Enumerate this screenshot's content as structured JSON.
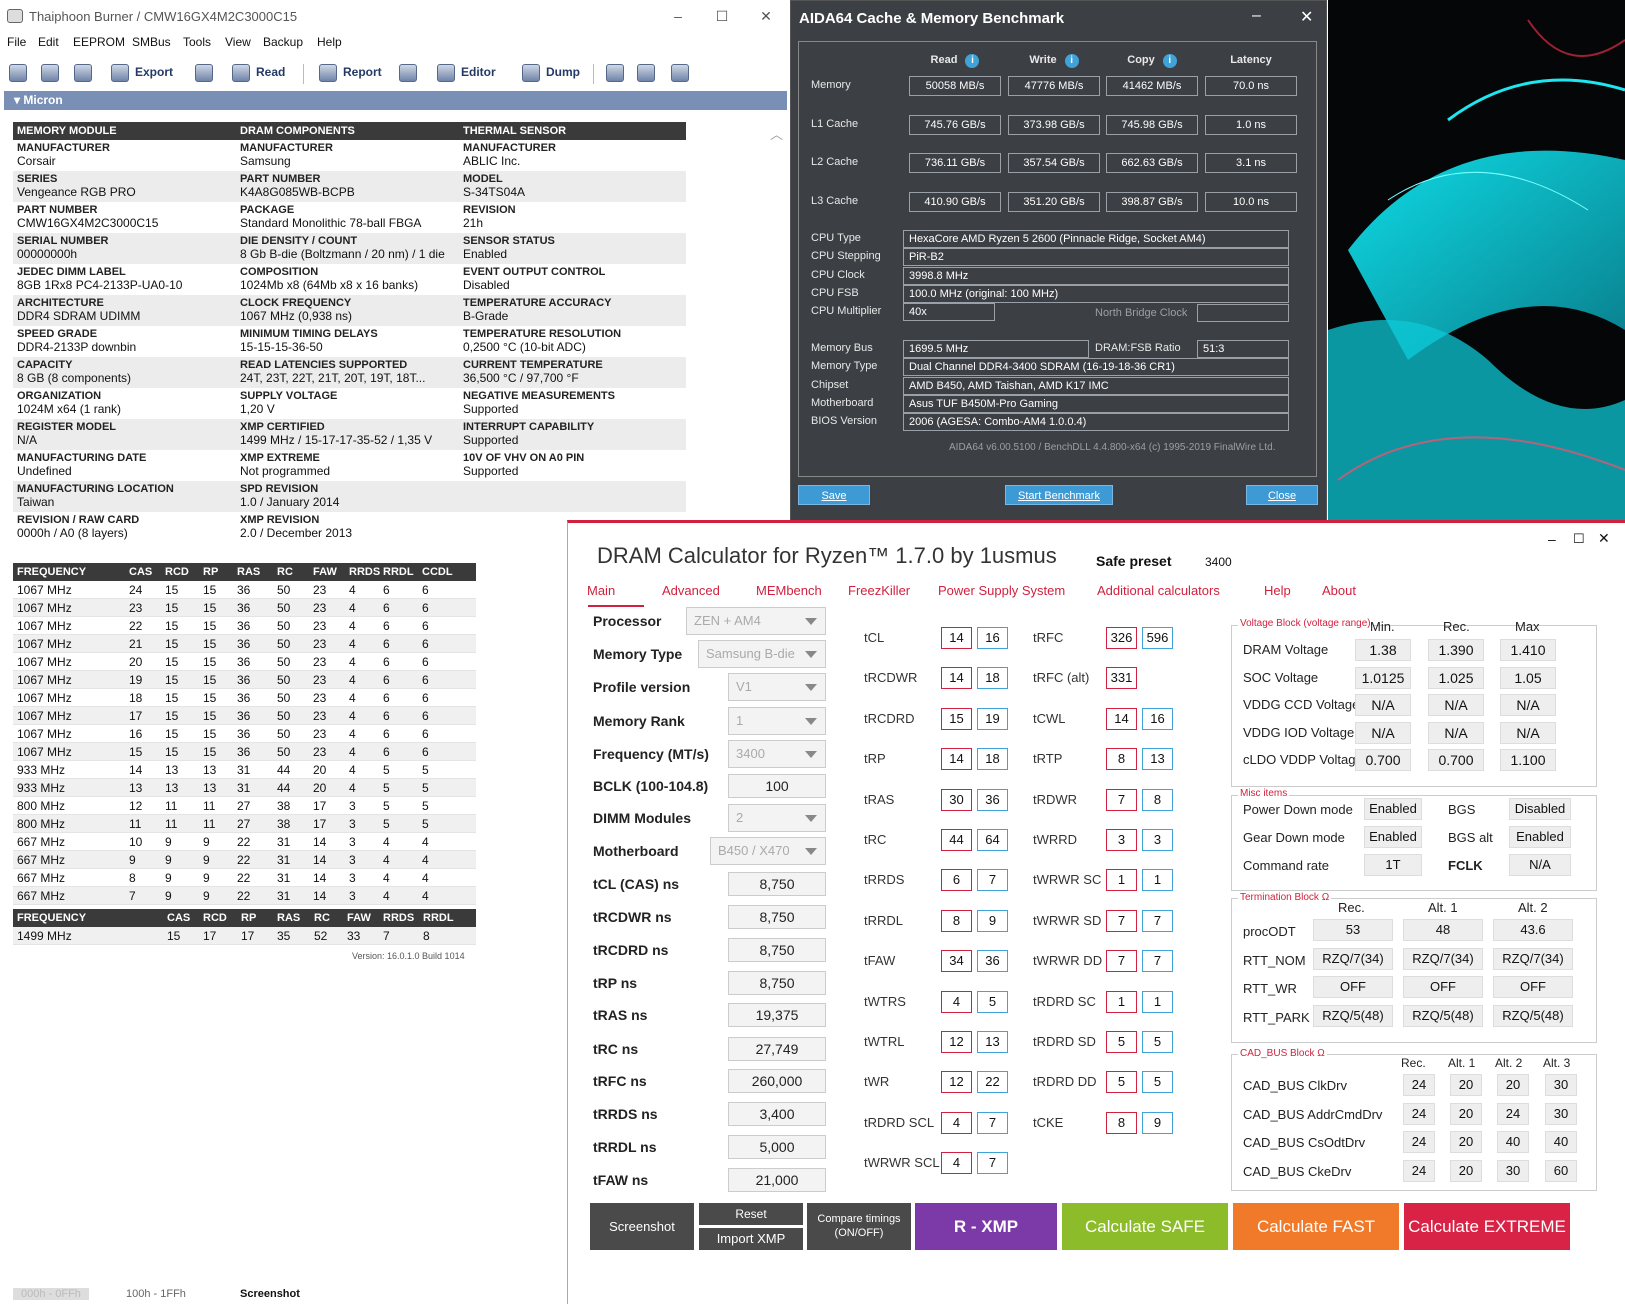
{
  "thaiphoon": {
    "title": "Thaiphoon Burner / CMW16GX4M2C3000C15",
    "menu": [
      "File",
      "Edit",
      "EEPROM",
      "SMBus",
      "Tools",
      "View",
      "Backup",
      "Help"
    ],
    "toolbar": {
      "export": "Export",
      "read": "Read",
      "report": "Report",
      "editor": "Editor",
      "dump": "Dump"
    },
    "band": "Micron",
    "sections": [
      {
        "header": "MEMORY MODULE",
        "rows": [
          [
            "MANUFACTURER",
            "Corsair"
          ],
          [
            "SERIES",
            "Vengeance RGB PRO"
          ],
          [
            "PART NUMBER",
            "CMW16GX4M2C3000C15"
          ],
          [
            "SERIAL NUMBER",
            "00000000h"
          ],
          [
            "JEDEC DIMM LABEL",
            "8GB 1Rx8 PC4-2133P-UA0-10"
          ],
          [
            "ARCHITECTURE",
            "DDR4 SDRAM UDIMM"
          ],
          [
            "SPEED GRADE",
            "DDR4-2133P downbin"
          ],
          [
            "CAPACITY",
            "8 GB (8 components)"
          ],
          [
            "ORGANIZATION",
            "1024M x64 (1 rank)"
          ],
          [
            "REGISTER MODEL",
            "N/A"
          ],
          [
            "MANUFACTURING DATE",
            "Undefined"
          ],
          [
            "MANUFACTURING LOCATION",
            "Taiwan"
          ],
          [
            "REVISION / RAW CARD",
            "0000h / A0 (8 layers)"
          ]
        ]
      },
      {
        "header": "DRAM COMPONENTS",
        "rows": [
          [
            "MANUFACTURER",
            "Samsung"
          ],
          [
            "PART NUMBER",
            "K4A8G085WB-BCPB"
          ],
          [
            "PACKAGE",
            "Standard Monolithic 78-ball FBGA"
          ],
          [
            "DIE DENSITY / COUNT",
            "8 Gb B-die (Boltzmann / 20 nm) / 1 die"
          ],
          [
            "COMPOSITION",
            "1024Mb x8 (64Mb x8 x 16 banks)"
          ],
          [
            "CLOCK FREQUENCY",
            "1067 MHz (0,938 ns)"
          ],
          [
            "MINIMUM TIMING DELAYS",
            "15-15-15-36-50"
          ],
          [
            "READ LATENCIES SUPPORTED",
            "24T, 23T, 22T, 21T, 20T, 19T, 18T..."
          ],
          [
            "SUPPLY VOLTAGE",
            "1,20 V"
          ],
          [
            "XMP CERTIFIED",
            "1499 MHz / 15-17-17-35-52 / 1,35 V"
          ],
          [
            "XMP EXTREME",
            "Not programmed"
          ],
          [
            "SPD REVISION",
            "1.0 / January 2014"
          ],
          [
            "XMP REVISION",
            "2.0 / December 2013"
          ]
        ]
      },
      {
        "header": "THERMAL SENSOR",
        "rows": [
          [
            "MANUFACTURER",
            "ABLIC Inc."
          ],
          [
            "MODEL",
            "S-34TS04A"
          ],
          [
            "REVISION",
            "21h"
          ],
          [
            "SENSOR STATUS",
            "Enabled"
          ],
          [
            "EVENT OUTPUT CONTROL",
            "Disabled"
          ],
          [
            "TEMPERATURE ACCURACY",
            "B-Grade"
          ],
          [
            "TEMPERATURE RESOLUTION",
            "0,2500 °C (10-bit ADC)"
          ],
          [
            "CURRENT TEMPERATURE",
            "36,500 °C / 97,700 °F"
          ],
          [
            "NEGATIVE MEASUREMENTS",
            "Supported"
          ],
          [
            "INTERRUPT CAPABILITY",
            "Supported"
          ],
          [
            "10V OF VHV ON A0 PIN",
            "Supported"
          ],
          [
            "",
            ""
          ],
          [
            "",
            ""
          ]
        ]
      }
    ],
    "freq_headers": [
      "FREQUENCY",
      "CAS",
      "RCD",
      "RP",
      "RAS",
      "RC",
      "FAW",
      "RRDS",
      "RRDL",
      "CCDL"
    ],
    "freq_rows": [
      [
        "1067 MHz",
        "24",
        "15",
        "15",
        "36",
        "50",
        "23",
        "4",
        "6",
        "6"
      ],
      [
        "1067 MHz",
        "23",
        "15",
        "15",
        "36",
        "50",
        "23",
        "4",
        "6",
        "6"
      ],
      [
        "1067 MHz",
        "22",
        "15",
        "15",
        "36",
        "50",
        "23",
        "4",
        "6",
        "6"
      ],
      [
        "1067 MHz",
        "21",
        "15",
        "15",
        "36",
        "50",
        "23",
        "4",
        "6",
        "6"
      ],
      [
        "1067 MHz",
        "20",
        "15",
        "15",
        "36",
        "50",
        "23",
        "4",
        "6",
        "6"
      ],
      [
        "1067 MHz",
        "19",
        "15",
        "15",
        "36",
        "50",
        "23",
        "4",
        "6",
        "6"
      ],
      [
        "1067 MHz",
        "18",
        "15",
        "15",
        "36",
        "50",
        "23",
        "4",
        "6",
        "6"
      ],
      [
        "1067 MHz",
        "17",
        "15",
        "15",
        "36",
        "50",
        "23",
        "4",
        "6",
        "6"
      ],
      [
        "1067 MHz",
        "16",
        "15",
        "15",
        "36",
        "50",
        "23",
        "4",
        "6",
        "6"
      ],
      [
        "1067 MHz",
        "15",
        "15",
        "15",
        "36",
        "50",
        "23",
        "4",
        "6",
        "6"
      ],
      [
        "933 MHz",
        "14",
        "13",
        "13",
        "31",
        "44",
        "20",
        "4",
        "5",
        "5"
      ],
      [
        "933 MHz",
        "13",
        "13",
        "13",
        "31",
        "44",
        "20",
        "4",
        "5",
        "5"
      ],
      [
        "800 MHz",
        "12",
        "11",
        "11",
        "27",
        "38",
        "17",
        "3",
        "5",
        "5"
      ],
      [
        "800 MHz",
        "11",
        "11",
        "11",
        "27",
        "38",
        "17",
        "3",
        "5",
        "5"
      ],
      [
        "667 MHz",
        "10",
        "9",
        "9",
        "22",
        "31",
        "14",
        "3",
        "4",
        "4"
      ],
      [
        "667 MHz",
        "9",
        "9",
        "9",
        "22",
        "31",
        "14",
        "3",
        "4",
        "4"
      ],
      [
        "667 MHz",
        "8",
        "9",
        "9",
        "22",
        "31",
        "14",
        "3",
        "4",
        "4"
      ],
      [
        "667 MHz",
        "7",
        "9",
        "9",
        "22",
        "31",
        "14",
        "3",
        "4",
        "4"
      ]
    ],
    "xmp_headers": [
      "FREQUENCY",
      "CAS",
      "RCD",
      "RP",
      "RAS",
      "RC",
      "FAW",
      "RRDS",
      "RRDL"
    ],
    "xmp_row": [
      "1499 MHz",
      "15",
      "17",
      "17",
      "35",
      "52",
      "33",
      "7",
      "8"
    ],
    "version": "Version: 16.0.1.0 Build 1014",
    "bottom_tabs": [
      "000h - 0FFh",
      "100h - 1FFh",
      "Screenshot"
    ]
  },
  "aida": {
    "title": "AIDA64 Cache & Memory Benchmark",
    "cols": [
      "Read",
      "Write",
      "Copy",
      "Latency"
    ],
    "rows": [
      {
        "label": "Memory",
        "vals": [
          "50058 MB/s",
          "47776 MB/s",
          "41462 MB/s",
          "70.0 ns"
        ]
      },
      {
        "label": "L1 Cache",
        "vals": [
          "745.76 GB/s",
          "373.98 GB/s",
          "745.98 GB/s",
          "1.0 ns"
        ]
      },
      {
        "label": "L2 Cache",
        "vals": [
          "736.11 GB/s",
          "357.54 GB/s",
          "662.63 GB/s",
          "3.1 ns"
        ]
      },
      {
        "label": "L3 Cache",
        "vals": [
          "410.90 GB/s",
          "351.20 GB/s",
          "398.87 GB/s",
          "10.0 ns"
        ]
      }
    ],
    "cpu": [
      {
        "label": "CPU Type",
        "value": "HexaCore AMD Ryzen 5 2600  (Pinnacle Ridge, Socket AM4)"
      },
      {
        "label": "CPU Stepping",
        "value": "PiR-B2"
      },
      {
        "label": "CPU Clock",
        "value": "3998.8 MHz"
      },
      {
        "label": "CPU FSB",
        "value": "100.0 MHz  (original: 100 MHz)"
      },
      {
        "label": "CPU Multiplier",
        "value": "40x"
      }
    ],
    "nb_label": "North Bridge Clock",
    "mem": [
      {
        "label": "Memory Bus",
        "value": "1699.5 MHz"
      },
      {
        "label": "Memory Type",
        "value": "Dual Channel DDR4-3400 SDRAM  (16-19-18-36 CR1)"
      },
      {
        "label": "Chipset",
        "value": "AMD B450, AMD Taishan, AMD K17 IMC"
      },
      {
        "label": "Motherboard",
        "value": "Asus TUF B450M-Pro Gaming"
      },
      {
        "label": "BIOS Version",
        "value": "2006  (AGESA: Combo-AM4 1.0.0.4)"
      }
    ],
    "ratio_label": "DRAM:FSB Ratio",
    "ratio_value": "51:3",
    "footer": "AIDA64 v6.00.5100 / BenchDLL 4.4.800-x64  (c) 1995-2019 FinalWire Ltd.",
    "buttons": {
      "save": "Save",
      "start": "Start Benchmark",
      "close": "Close"
    }
  },
  "dram": {
    "title": "DRAM Calculator for Ryzen™ 1.7.0 by 1usmus",
    "preset_label": "Safe preset",
    "preset_value": "3400",
    "nav": [
      "Main",
      "Advanced",
      "MEMbench",
      "FreezKiller",
      "Power Supply System",
      "Additional calculators",
      "Help",
      "About"
    ],
    "params": [
      {
        "label": "Processor",
        "value": "ZEN + AM4",
        "kind": "select"
      },
      {
        "label": "Memory Type",
        "value": "Samsung B-die",
        "kind": "select"
      },
      {
        "label": "Profile version",
        "value": "V1",
        "kind": "select"
      },
      {
        "label": "Memory Rank",
        "value": "1",
        "kind": "select"
      },
      {
        "label": "Frequency (MT/s)",
        "value": "3400",
        "kind": "select"
      },
      {
        "label": "BCLK (100-104.8)",
        "value": "100",
        "kind": "input"
      },
      {
        "label": "DIMM Modules",
        "value": "2",
        "kind": "select"
      },
      {
        "label": "Motherboard",
        "value": "B450 / X470",
        "kind": "select"
      },
      {
        "label": "tCL (CAS) ns",
        "value": "8,750",
        "kind": "input"
      },
      {
        "label": "tRCDWR ns",
        "value": "8,750",
        "kind": "input"
      },
      {
        "label": "tRCDRD ns",
        "value": "8,750",
        "kind": "input"
      },
      {
        "label": "tRP ns",
        "value": "8,750",
        "kind": "input"
      },
      {
        "label": "tRAS ns",
        "value": "19,375",
        "kind": "input"
      },
      {
        "label": "tRC ns",
        "value": "27,749",
        "kind": "input"
      },
      {
        "label": "tRFC ns",
        "value": "260,000",
        "kind": "input"
      },
      {
        "label": "tRRDS ns",
        "value": "3,400",
        "kind": "input"
      },
      {
        "label": "tRRDL ns",
        "value": "5,000",
        "kind": "input"
      },
      {
        "label": "tFAW ns",
        "value": "21,000",
        "kind": "input"
      }
    ],
    "timings_left": [
      {
        "label": "tCL",
        "a": "14",
        "b": "16"
      },
      {
        "label": "tRCDWR",
        "a": "14",
        "b": "18"
      },
      {
        "label": "tRCDRD",
        "a": "15",
        "b": "19"
      },
      {
        "label": "tRP",
        "a": "14",
        "b": "18"
      },
      {
        "label": "tRAS",
        "a": "30",
        "b": "36"
      },
      {
        "label": "tRC",
        "a": "44",
        "b": "64"
      },
      {
        "label": "tRRDS",
        "a": "6",
        "b": "7"
      },
      {
        "label": "tRRDL",
        "a": "8",
        "b": "9"
      },
      {
        "label": "tFAW",
        "a": "34",
        "b": "36"
      },
      {
        "label": "tWTRS",
        "a": "4",
        "b": "5"
      },
      {
        "label": "tWTRL",
        "a": "12",
        "b": "13"
      },
      {
        "label": "tWR",
        "a": "12",
        "b": "22"
      },
      {
        "label": "tRDRD SCL",
        "a": "4",
        "b": "7"
      },
      {
        "label": "tWRWR SCL",
        "a": "4",
        "b": "7"
      }
    ],
    "timings_right": [
      {
        "label": "tRFC",
        "a": "326",
        "b": "596"
      },
      {
        "label": "tRFC (alt)",
        "a": "331",
        "b": ""
      },
      {
        "label": "tCWL",
        "a": "14",
        "b": "16"
      },
      {
        "label": "tRTP",
        "a": "8",
        "b": "13"
      },
      {
        "label": "tRDWR",
        "a": "7",
        "b": "8"
      },
      {
        "label": "tWRRD",
        "a": "3",
        "b": "3"
      },
      {
        "label": "tWRWR SC",
        "a": "1",
        "b": "1"
      },
      {
        "label": "tWRWR SD",
        "a": "7",
        "b": "7"
      },
      {
        "label": "tWRWR DD",
        "a": "7",
        "b": "7"
      },
      {
        "label": "tRDRD SC",
        "a": "1",
        "b": "1"
      },
      {
        "label": "tRDRD SD",
        "a": "5",
        "b": "5"
      },
      {
        "label": "tRDRD DD",
        "a": "5",
        "b": "5"
      },
      {
        "label": "tCKE",
        "a": "8",
        "b": "9"
      }
    ],
    "voltage": {
      "title": "Voltage Block (voltage range)",
      "cols": [
        "Min.",
        "Rec.",
        "Max"
      ],
      "rows": [
        {
          "label": "DRAM Voltage",
          "v": [
            "1.38",
            "1.390",
            "1.410"
          ]
        },
        {
          "label": "SOC Voltage",
          "v": [
            "1.0125",
            "1.025",
            "1.05"
          ]
        },
        {
          "label": "VDDG  CCD Voltage",
          "v": [
            "N/A",
            "N/A",
            "N/A"
          ]
        },
        {
          "label": "VDDG  IOD Voltage",
          "v": [
            "N/A",
            "N/A",
            "N/A"
          ]
        },
        {
          "label": "cLDO VDDP Voltage",
          "v": [
            "0.700",
            "0.700",
            "1.100"
          ]
        }
      ]
    },
    "misc": {
      "title": "Misc items",
      "rows": [
        {
          "l1": "Power Down mode",
          "v1": "Enabled",
          "l2": "BGS",
          "v2": "Disabled"
        },
        {
          "l1": "Gear Down mode",
          "v1": "Enabled",
          "l2": "BGS alt",
          "v2": "Enabled"
        },
        {
          "l1": "Command rate",
          "v1": "1T",
          "l2": "FCLK",
          "v2": "N/A"
        }
      ]
    },
    "term": {
      "title": "Termination Block Ω",
      "cols": [
        "Rec.",
        "Alt. 1",
        "Alt. 2"
      ],
      "rows": [
        {
          "label": "procODT",
          "v": [
            "53",
            "48",
            "43.6"
          ]
        },
        {
          "label": "RTT_NOM",
          "v": [
            "RZQ/7(34)",
            "RZQ/7(34)",
            "RZQ/7(34)"
          ]
        },
        {
          "label": "RTT_WR",
          "v": [
            "OFF",
            "OFF",
            "OFF"
          ]
        },
        {
          "label": "RTT_PARK",
          "v": [
            "RZQ/5(48)",
            "RZQ/5(48)",
            "RZQ/5(48)"
          ]
        }
      ]
    },
    "cad": {
      "title": "CAD_BUS Block Ω",
      "cols": [
        "Rec.",
        "Alt. 1",
        "Alt. 2",
        "Alt. 3"
      ],
      "rows": [
        {
          "label": "CAD_BUS ClkDrv",
          "v": [
            "24",
            "20",
            "20",
            "30"
          ]
        },
        {
          "label": "CAD_BUS AddrCmdDrv",
          "v": [
            "24",
            "20",
            "24",
            "30"
          ]
        },
        {
          "label": "CAD_BUS CsOdtDrv",
          "v": [
            "24",
            "20",
            "40",
            "40"
          ]
        },
        {
          "label": "CAD_BUS CkeDrv",
          "v": [
            "24",
            "20",
            "30",
            "60"
          ]
        }
      ]
    },
    "buttons": {
      "screenshot": "Screenshot",
      "reset": "Reset",
      "import_xmp": "Import XMP",
      "compare1": "Compare timings",
      "compare2": "(ON/OFF)",
      "rxmp": "R - XMP",
      "safe": "Calculate SAFE",
      "fast": "Calculate FAST",
      "extreme": "Calculate EXTREME"
    },
    "colors": {
      "accent": "#d0223f",
      "blue": "#3fa3d8",
      "rxmp": "#7b3aa8",
      "safe": "#8cbc2a",
      "fast": "#f07a2a",
      "extreme": "#d92346"
    }
  }
}
